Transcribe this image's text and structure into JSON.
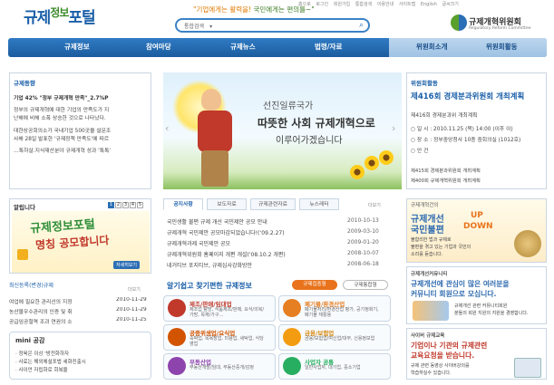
{
  "header": {
    "logo": "규제정보포털",
    "logo_a": "규제",
    "logo_b": "정보",
    "logo_c": "포털",
    "slogan_a": "\"기업에게는 활력을! ",
    "slogan_b": "국민에게는 편의를~\"",
    "top_links": [
      "홈으로",
      "로그인",
      "회원가입",
      "통합검색",
      "이용안내",
      "사이트맵",
      "English",
      "글씨크기"
    ],
    "search_scope": "통합검색",
    "org_name": "규제개혁위원회",
    "org_name_en": "Regulatory Reform Committee"
  },
  "nav": {
    "items": [
      "규제정보",
      "참여마당",
      "규제뉴스",
      "법령/자료"
    ],
    "right_items": [
      "위원회소개",
      "위원회활동"
    ]
  },
  "left": {
    "news_title": "규제동향",
    "news_headline": "기업 42% \"정부 규제개혁 만족\"_2.7%P",
    "news_body": [
      "정부의 규제개혁에 대한 기업의 만족도가 지",
      "난해에 비해 소폭 상승한 것으로 나타났다.",
      "",
      "대한상공회의소가 국내기업 500곳을 설문조",
      "사해 28일 발표한 '규제정책 만족도'에 따르",
      "…톡하살.지식재산분야 규제개혁 성과 '톡톡'"
    ],
    "notice_title": "알립니다",
    "notice_pages": [
      "1",
      "2",
      "3",
      "4",
      "5"
    ],
    "promo_line1": "규제정보포털",
    "promo_line2": "명칭 공모합니다",
    "promo_button": "자세히보기",
    "latest_title": "최신등록(변경)규제",
    "latest_more": "더보기",
    "latest_items": [
      {
        "text": "여업에 필요한 관리선의 지정",
        "date": "2010-11-29"
      },
      {
        "text": "농산물우수관리의 인증 및 취",
        "date": "2010-11-29"
      },
      {
        "text": "공급임공철역 조과 연권의 소",
        "date": "2010-11-25"
      }
    ],
    "mini_title": "mini 공감",
    "mini_items": [
      "· 정육은 이상 '방전화하자",
      "· 사료는 해외체설포법 세화진출시",
      "· 사이언 자립화로 회복율"
    ]
  },
  "hero": {
    "caption1": "선진일류국가",
    "caption2": "따뜻한 사회 규제개혁으로",
    "caption3": "이루어가겠습니다"
  },
  "news_tabs": {
    "tabs": [
      "공지사항",
      "보도자료",
      "규제관련자료",
      "뉴스레터"
    ],
    "more": "더보기",
    "rows": [
      {
        "text": "국민생활 불편 규제 개선 국민제안 공모 안내",
        "date": "2010-10-13"
      },
      {
        "text": "규제개혁 국민제안 공모마감되었습니다!(‘09.2.27)",
        "date": "2009-03-10"
      },
      {
        "text": "규제개혁과제 국민제안 공모",
        "date": "2009-01-20"
      },
      {
        "text": "규제개혁위원회 홈페이지 개편 개설('08.10.2 개편)",
        "date": "2008-10-07"
      },
      {
        "text": "네거티브 포지티브, 규제심사강화방안",
        "date": "2008-06-18"
      }
    ]
  },
  "industry": {
    "title": "알기쉽고 찾기편한 규제정보",
    "btn1": "규제집중형",
    "btn2": "규제통합형",
    "cards": [
      {
        "head": "제조/판매/임대업",
        "sub": "제조업 탐방, 식품제조/판매, 요식/의복/가방, 목재/가구…",
        "color": "#c0392b"
      },
      {
        "head": "폐기물/환경산업",
        "sub": "폐기물처리/환경산업 평가, 공기정화기, 폐기물 재활용",
        "color": "#e67e22"
      },
      {
        "head": "공중위생업/요식업",
        "sub": "숙박업, 목욕장업, 미용업, 세탁업, 식당영업",
        "color": "#d35400"
      },
      {
        "head": "금융/보험업",
        "sub": "금융/보험업/여신업/대부, 신용정보업",
        "color": "#f39c12"
      },
      {
        "head": "부동산업",
        "sub": "부동산개발/임대, 부동산중개/감정",
        "color": "#8e44ad"
      },
      {
        "head": "사업자 공통",
        "sub": "일반사업자, 대기업, 중소기업",
        "color": "#27ae60"
      }
    ]
  },
  "right": {
    "committee_title": "위원회활동",
    "meeting_headline": "제416회 경제분과위원회 개최계획",
    "meeting_sub": "제416회 경제분과위 개최계획",
    "meeting_details": [
      "○ 일 시 : 2010.11.25 (목) 14:00 (이후 이)",
      "○ 장 소 : 정부중앙청사 10층 중회의실 (1012호)",
      "○ 안 건"
    ],
    "meeting_links": [
      "제415회 경제분과위원회 개최계획",
      "제400회 규제개혁위원회 개최계획"
    ],
    "banner1_title": "규제개혁건의",
    "banner1_head1": "규제개선",
    "banner1_head2": "국민불편",
    "banner1_up": "UP",
    "banner1_down": "DOWN",
    "banner1_body": [
      "불합리한 법과 규제로",
      "불편을 겪고 있는 기업과 국민의",
      "소리를 듣습니다."
    ],
    "banner2_title": "규제개선커뮤니티",
    "banner2_body": [
      "규제개선에 관심이 많은 여러분을",
      "커뮤니티 회원으로 모십니다."
    ],
    "banner2_sub": [
      "규제개선 관련 커뮤니티회원",
      "분들의 회원 지원의 지원을 경영합니다."
    ],
    "banner3_title": "사이버 규제교육",
    "banner3_body": [
      "기업이나 기관의 규제관련",
      "교육요청을 받습니다."
    ],
    "banner3_sub": [
      "규제 관련 동영상 사이버강의를",
      "학습하실수 있습니다."
    ]
  },
  "colors": {
    "primary": "#1c5c9e",
    "accent": "#e07a00",
    "green": "#3d8b2a"
  }
}
